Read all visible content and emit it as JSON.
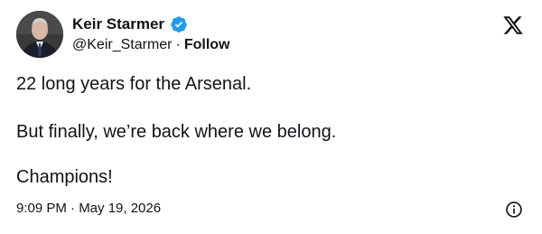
{
  "author": {
    "display_name": "Keir Starmer",
    "handle": "@Keir_Starmer",
    "separator": "·",
    "follow_label": "Follow",
    "verified_icon": "verified-badge-icon",
    "avatar_icon": "profile-avatar"
  },
  "header": {
    "logo_icon": "x-logo-icon"
  },
  "tweet": {
    "lines": [
      "22 long years for the Arsenal.",
      "But finally, we’re back where we belong.",
      "Champions!"
    ],
    "timestamp": "9:09 PM · May 19, 2026",
    "info_icon": "info-icon"
  },
  "colors": {
    "text": "#0f1419",
    "verified": "#1d9bf0",
    "background": "#ffffff"
  }
}
